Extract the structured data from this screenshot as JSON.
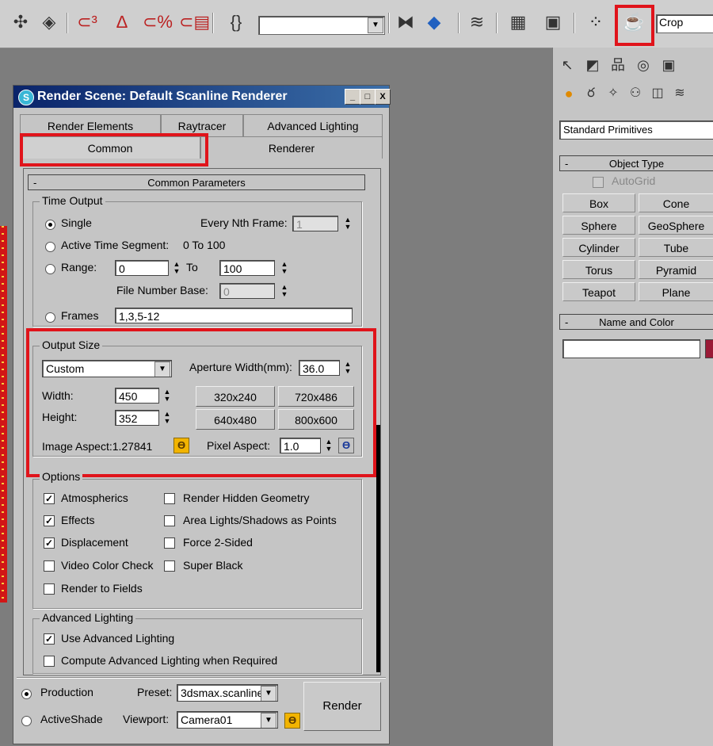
{
  "toolbar": {
    "crop_label": "Crop",
    "colors": {
      "highlight": "#e0141b"
    }
  },
  "dialog": {
    "title": "Render Scene: Default Scanline Renderer",
    "window_buttons": [
      "_",
      "□",
      "X"
    ],
    "tabs_row1": [
      "Render Elements",
      "Raytracer",
      "Advanced Lighting"
    ],
    "tabs_row2": [
      "Common",
      "Renderer"
    ],
    "rollout_title": "Common Parameters",
    "rollout_minus": "-",
    "time_output": {
      "group": "Time Output",
      "single": "Single",
      "every_nth": "Every Nth Frame:",
      "every_nth_value": "1",
      "active_segment": "Active Time Segment:",
      "active_segment_value": "0 To 100",
      "range": "Range:",
      "range_from": "0",
      "range_to_label": "To",
      "range_to": "100",
      "file_number_base": "File Number Base:",
      "file_number_base_value": "0",
      "frames": "Frames",
      "frames_value": "1,3,5-12"
    },
    "output_size": {
      "group": "Output Size",
      "preset": "Custom",
      "aperture_label": "Aperture Width(mm):",
      "aperture_value": "36.0",
      "width_label": "Width:",
      "width_value": "450",
      "height_label": "Height:",
      "height_value": "352",
      "presets": [
        "320x240",
        "720x486",
        "640x480",
        "800x600"
      ],
      "image_aspect": "Image Aspect:1.27841",
      "pixel_aspect_label": "Pixel Aspect:",
      "pixel_aspect_value": "1.0"
    },
    "options": {
      "group": "Options",
      "items": [
        {
          "label": "Atmospherics",
          "checked": true
        },
        {
          "label": "Render Hidden Geometry",
          "checked": false
        },
        {
          "label": "Effects",
          "checked": true
        },
        {
          "label": "Area Lights/Shadows as Points",
          "checked": false
        },
        {
          "label": "Displacement",
          "checked": true
        },
        {
          "label": "Force 2-Sided",
          "checked": false
        },
        {
          "label": "Video Color Check",
          "checked": false
        },
        {
          "label": "Super Black",
          "checked": false
        },
        {
          "label": "Render to Fields",
          "checked": false
        }
      ]
    },
    "advanced_lighting": {
      "group": "Advanced Lighting",
      "use": "Use Advanced Lighting",
      "compute": "Compute Advanced Lighting when Required"
    },
    "footer": {
      "production": "Production",
      "activeshade": "ActiveShade",
      "preset_label": "Preset:",
      "preset_value": "3dsmax.scanline",
      "viewport_label": "Viewport:",
      "viewport_value": "Camera01",
      "render": "Render"
    }
  },
  "command_panel": {
    "category": "Standard Primitives",
    "object_type": "Object Type",
    "autogrid": "AutoGrid",
    "buttons": [
      "Box",
      "Cone",
      "Sphere",
      "GeoSphere",
      "Cylinder",
      "Tube",
      "Torus",
      "Pyramid",
      "Teapot",
      "Plane"
    ],
    "name_and_color": "Name and Color",
    "minus": "-"
  }
}
